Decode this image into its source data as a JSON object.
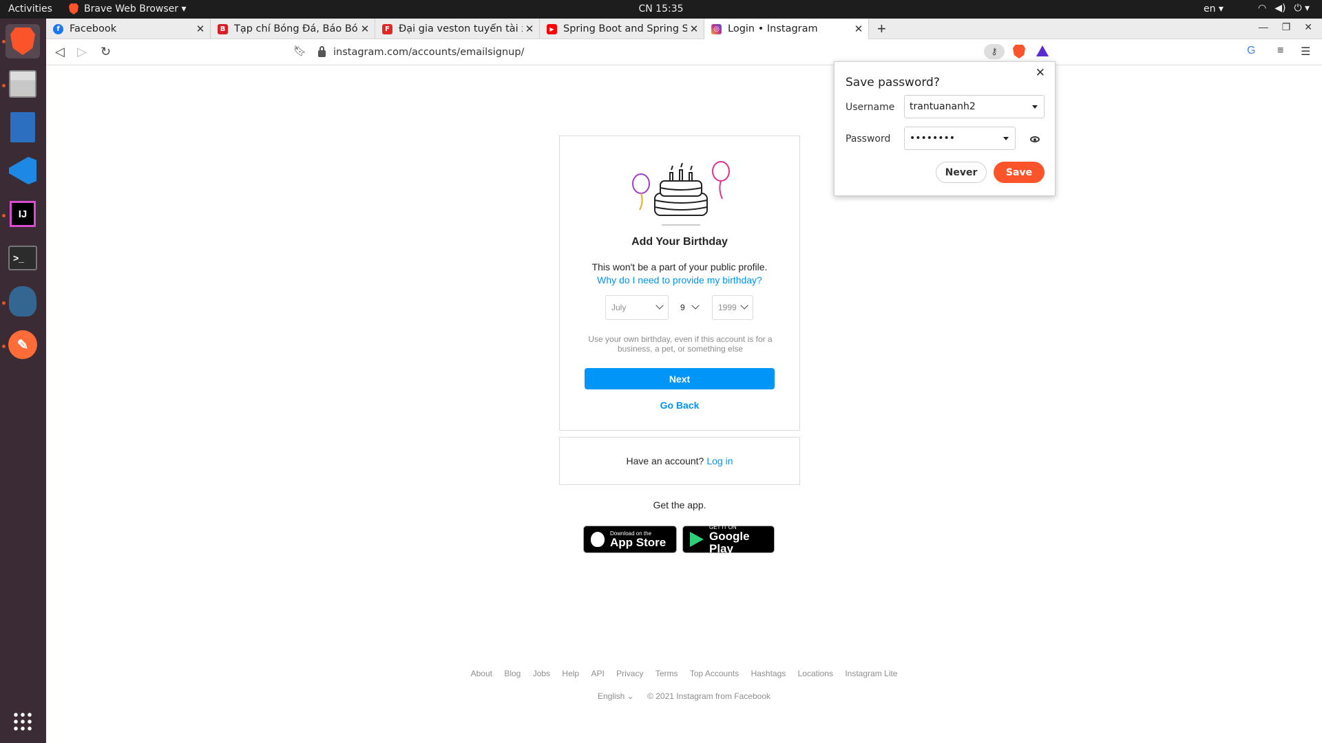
{
  "topbar": {
    "activities": "Activities",
    "app_name": "Brave Web Browser ▾",
    "clock": "CN 15:35",
    "lang": "en ▾",
    "tray_icons": [
      "wifi-icon",
      "volume-icon",
      "power-icon"
    ]
  },
  "dock": {
    "apps": [
      "Brave",
      "Files",
      "LibreOffice Writer",
      "Visual Studio Code",
      "IntelliJ IDEA",
      "Terminal",
      "pgAdmin",
      "Postman"
    ],
    "show_apps_icon": "grid-icon"
  },
  "browser": {
    "tabs": [
      {
        "title": "Facebook",
        "favicon": "facebook-icon",
        "color": "#1877f2"
      },
      {
        "title": "Tạp chí Bóng Đá, Báo Bóng",
        "favicon": "bongda-icon",
        "color": "#d61f26"
      },
      {
        "title": "Đại gia veston tuyển tài xế",
        "favicon": "flipboard-icon",
        "color": "#e12828"
      },
      {
        "title": "Spring Boot and Spring Sec",
        "favicon": "youtube-icon",
        "color": "#ff0000"
      },
      {
        "title": "Login • Instagram",
        "favicon": "instagram-icon",
        "color": "#c13584"
      }
    ],
    "new_tab": "+",
    "url": "instagram.com/accounts/emailsignup/"
  },
  "card": {
    "heading": "Add Your Birthday",
    "subtitle": "This won't be a part of your public profile.",
    "why_link": "Why do I need to provide my birthday?",
    "month": "July",
    "day": "9",
    "year": "1999",
    "hint": "Use your own birthday, even if this account is for a business, a pet, or something else",
    "next": "Next",
    "go_back": "Go Back"
  },
  "account": {
    "prompt": "Have an account?",
    "login": "Log in"
  },
  "app": {
    "get_app": "Get the app.",
    "appstore_small": "Download on the",
    "appstore_big": "App Store",
    "play_small": "GET IT ON",
    "play_big": "Google Play"
  },
  "footer": {
    "links": [
      "About",
      "Blog",
      "Jobs",
      "Help",
      "API",
      "Privacy",
      "Terms",
      "Top Accounts",
      "Hashtags",
      "Locations",
      "Instagram Lite"
    ],
    "language": "English ⌄",
    "copyright": "© 2021 Instagram from Facebook"
  },
  "save_password": {
    "title": "Save password?",
    "username_label": "Username",
    "username_value": "trantuananh2",
    "password_label": "Password",
    "password_value": "••••••••",
    "never": "Never",
    "save": "Save"
  },
  "colors": {
    "instagram_blue": "#0095f6",
    "brave_orange": "#fb542b",
    "dock_bg": "#3a2b34"
  }
}
